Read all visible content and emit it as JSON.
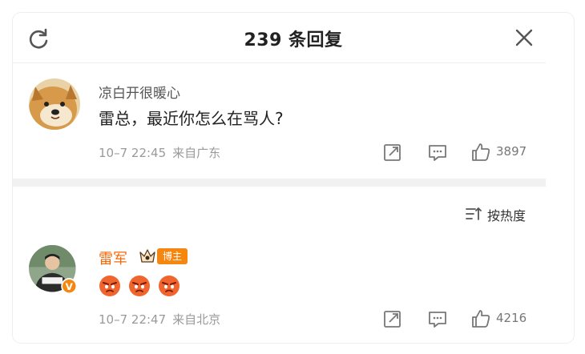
{
  "header": {
    "title": "239 条回复"
  },
  "comments": [
    {
      "username": "凉白开很暖心",
      "text": "雷总，最近你怎么在骂人?",
      "time": "10–7 22:45",
      "location": "来自广东",
      "likes": "3897",
      "icons": [
        "dog-avatar",
        "share-icon",
        "comment-icon",
        "like-icon"
      ]
    },
    {
      "username": "雷军",
      "badge": "博主",
      "emoji_count": 3,
      "time": "10–7 22:47",
      "location": "来自北京",
      "likes": "4216",
      "icons": [
        "person-avatar",
        "verified-badge-icon",
        "crown-icon",
        "angry-face-emoji"
      ]
    }
  ],
  "sort": {
    "label": "按热度"
  },
  "colors": {
    "accent_orange": "#f26a0e",
    "badge_orange": "#f5860f",
    "separator": "#f1f1f1",
    "meta_gray": "#9a9a9a"
  }
}
